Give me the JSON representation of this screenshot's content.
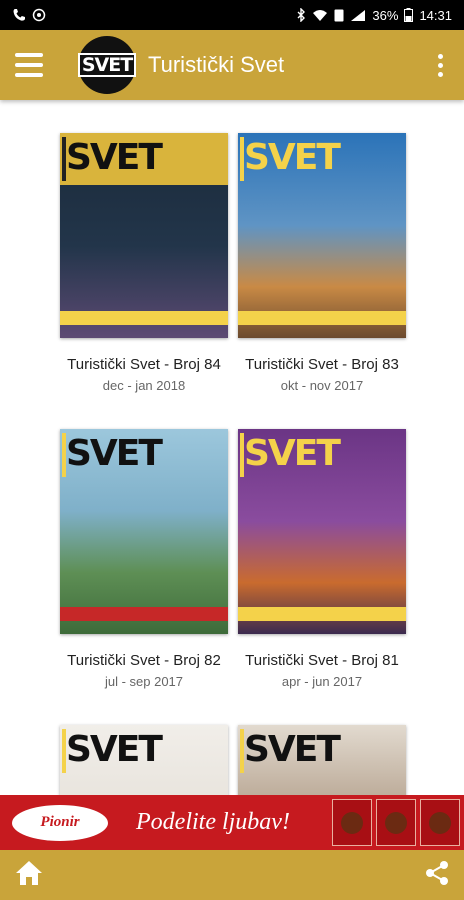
{
  "status_bar": {
    "time": "14:31",
    "battery": "36%",
    "icons": [
      "phone-icon",
      "whatsapp-icon",
      "bluetooth-icon",
      "wifi-icon",
      "signal-icon",
      "battery-icon"
    ]
  },
  "app_bar": {
    "logo_text": "SVET",
    "title": "Turistički Svet",
    "menu_icon": "hamburger-icon",
    "overflow_icon": "more-vert-icon"
  },
  "issues": [
    {
      "title": "Turistički Svet - Broj 84",
      "date": "dec - jan 2018",
      "cover_colors": [
        "#1b2a3a",
        "#5d4a73"
      ]
    },
    {
      "title": "Turistički Svet - Broj 83",
      "date": "okt - nov 2017",
      "cover_colors": [
        "#1f5f9c",
        "#c98a45"
      ]
    },
    {
      "title": "Turistički Svet - Broj 82",
      "date": "jul - sep 2017",
      "cover_colors": [
        "#7fb0c9",
        "#3e6b3a"
      ]
    },
    {
      "title": "Turistički Svet - Broj 81",
      "date": "apr - jun 2017",
      "cover_colors": [
        "#7a3f8f",
        "#c96b2e"
      ]
    },
    {
      "title": "",
      "date": "",
      "cover_colors": [
        "#e9e6e1",
        "#bdb7ad"
      ]
    },
    {
      "title": "",
      "date": "",
      "cover_colors": [
        "#d8cfc4",
        "#6d5a4a"
      ]
    }
  ],
  "ad": {
    "brand": "Pionir",
    "slogan": "Podelite ljubav!"
  },
  "bottom_bar": {
    "home_icon": "home-icon",
    "share_icon": "share-icon"
  },
  "colors": {
    "accent": "#c9a43a",
    "ad_red": "#c61a1f"
  }
}
